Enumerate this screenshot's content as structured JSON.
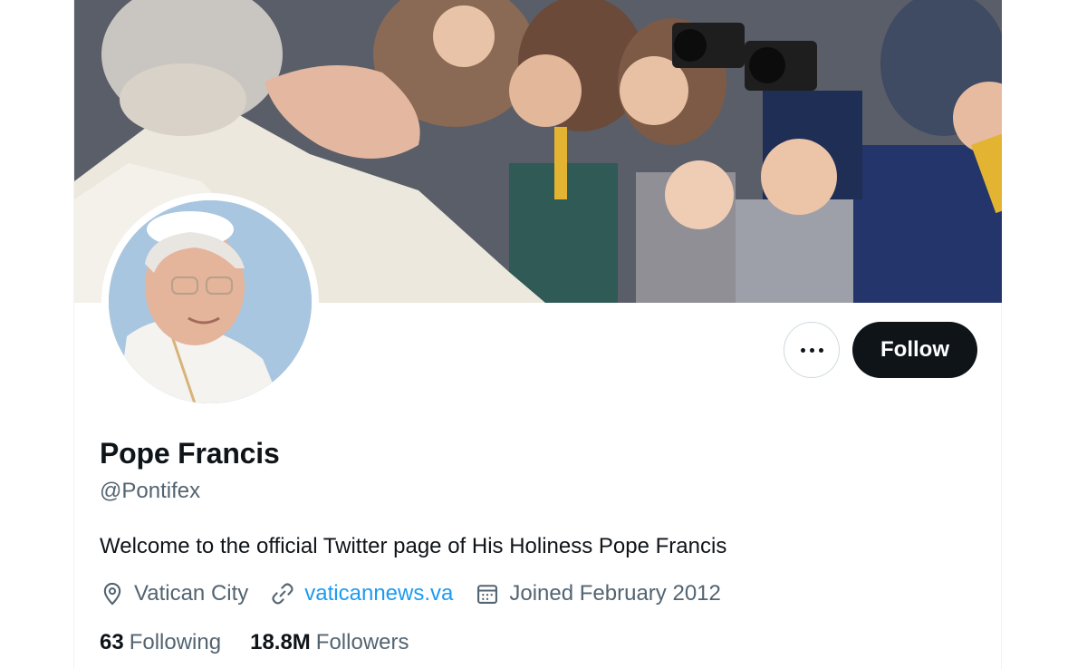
{
  "profile": {
    "display_name": "Pope Francis",
    "handle": "@Pontifex",
    "bio": "Welcome to the official Twitter page of His Holiness Pope Francis",
    "location": "Vatican City",
    "website": "vaticannews.va",
    "joined": "Joined February 2012"
  },
  "stats": {
    "following_count": "63",
    "following_label": "Following",
    "followers_count": "18.8M",
    "followers_label": "Followers"
  },
  "actions": {
    "follow_label": "Follow",
    "more_icon": "more-horizontal-icon"
  },
  "icons": {
    "location": "location-pin-icon",
    "website": "link-icon",
    "joined": "calendar-icon"
  },
  "colors": {
    "text_primary": "#0f1419",
    "text_secondary": "#536471",
    "link": "#1d9bf0",
    "follow_bg": "#0f1419"
  }
}
